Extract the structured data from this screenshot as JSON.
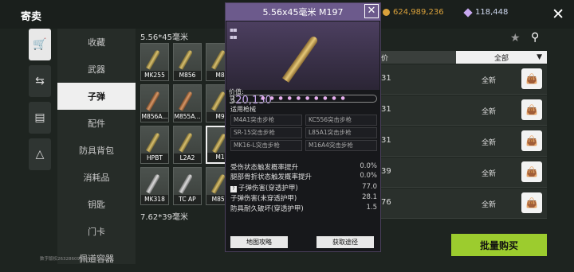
{
  "header": {
    "title": "寄卖",
    "gold_amount": "624,989,236",
    "gem_amount": "118,448"
  },
  "categories": [
    "收藏",
    "武器",
    "子弹",
    "配件",
    "防具背包",
    "消耗品",
    "钥匙",
    "门卡",
    "佩道容器"
  ],
  "sections": [
    {
      "title": "5.56*45毫米",
      "items": [
        "MK255",
        "M856",
        "M8",
        "M856A...",
        "M855A...",
        "M9",
        "HPBT",
        "L2A2",
        "M1",
        "MK318",
        "TC AP",
        "M855"
      ]
    },
    {
      "title": "7.62*39毫米",
      "items": []
    }
  ],
  "listing_header": {
    "left_partial": "价",
    "filter_label": "全部"
  },
  "listings": [
    {
      "qty": "31",
      "condition": "全新"
    },
    {
      "qty": "31",
      "condition": "全新"
    },
    {
      "qty": "31",
      "condition": "全新"
    },
    {
      "qty": "39",
      "condition": "全新"
    },
    {
      "qty": "76",
      "condition": "全新"
    }
  ],
  "buy_button": "批量购买",
  "footer_text": "数字版权2632860940-08-23-01:45",
  "popup": {
    "title": "5.56x45毫米 M197",
    "price_label": "价值:",
    "price_prefix": "3",
    "price_value": "20,130",
    "compatible_label": "适用枪械",
    "guns": [
      "M4A1突击步枪",
      "KC556突击步枪",
      "SR-15突击步枪",
      "L85A1突击步枪",
      "MK16-L突击步枪",
      "M16A4突击步枪"
    ],
    "stats": [
      {
        "label": "受伤状态触发概率提升",
        "value": "0.0%"
      },
      {
        "label": "腿部骨折状态触发概率提升",
        "value": "0.0%"
      },
      {
        "label": "子弹伤害(穿透护甲)",
        "value": "77.0"
      },
      {
        "label": "子弹伤害(未穿透护甲)",
        "value": "28.1"
      },
      {
        "label": "防具耐久破坏(穿透护甲)",
        "value": "1.5"
      }
    ],
    "btn_map": "地图攻略",
    "btn_source": "获取途径"
  },
  "colors": {
    "accent_green": "#9ccc2e",
    "popup_header": "#6c5a8c",
    "price_purple": "#c8a8f0"
  }
}
